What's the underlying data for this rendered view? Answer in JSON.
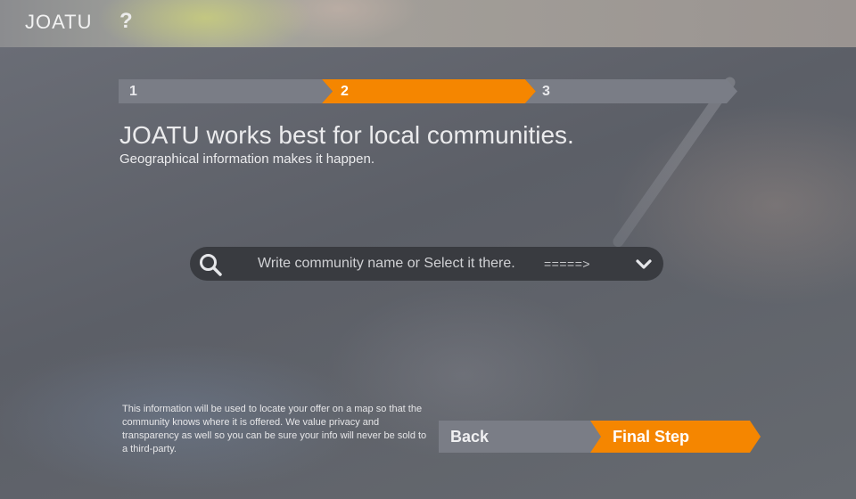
{
  "header": {
    "logo": "JOATU",
    "help_label": "?"
  },
  "stepper": {
    "steps": [
      {
        "label": "1",
        "state": "inactive"
      },
      {
        "label": "2",
        "state": "active"
      },
      {
        "label": "3",
        "state": "inactive"
      }
    ]
  },
  "main": {
    "headline": "JOATU works best for local communities.",
    "subline": "Geographical information makes it happen."
  },
  "search": {
    "placeholder": "Write community name or Select it there.",
    "arrow_hint": "=====>",
    "icon": "search-icon",
    "dropdown_icon": "chevron-down-icon"
  },
  "privacy_text": "This information will be used to locate your offer on a map so that the community knows where it is offered. We value privacy and transparency as well so you can be sure your info will never be sold to a third-party.",
  "nav": {
    "back_label": "Back",
    "next_label": "Final Step"
  },
  "colors": {
    "accent": "#f58600",
    "step_inactive": "#7a7d86",
    "search_bg": "#393b40"
  }
}
